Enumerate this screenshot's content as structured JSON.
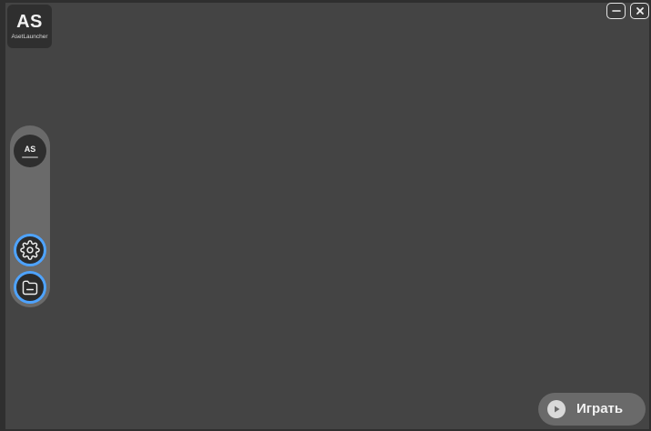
{
  "app": {
    "logo_abbr": "AS",
    "logo_name": "AsetLauncher"
  },
  "window_controls": {
    "minimize_icon": "minimize-icon",
    "close_icon": "close-icon"
  },
  "sidebar": {
    "profile_abbr": "AS",
    "settings_icon": "gear-icon",
    "folder_icon": "folder-icon"
  },
  "play_button": {
    "label": "Играть",
    "icon": "play-icon"
  },
  "colors": {
    "background": "#444444",
    "accent": "#4ea3ff",
    "panel": "#6a6a6a"
  }
}
